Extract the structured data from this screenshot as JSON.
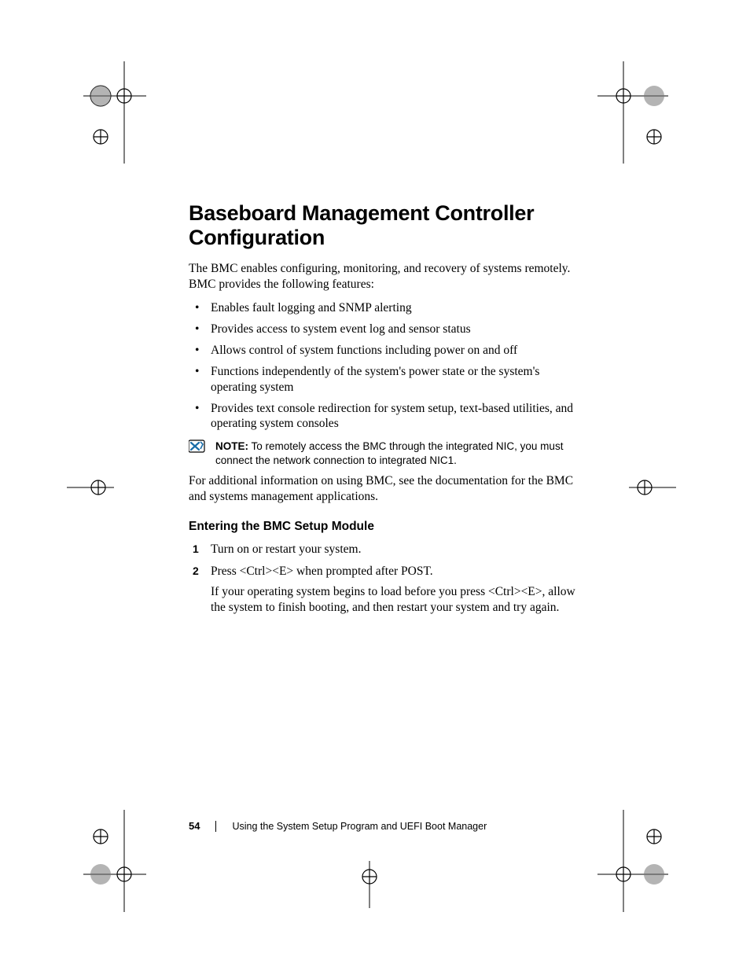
{
  "heading": "Baseboard Management Controller Configuration",
  "intro": "The BMC enables configuring, monitoring, and recovery of systems remotely. BMC provides the following features:",
  "bullets": [
    "Enables fault logging and SNMP alerting",
    "Provides access to system event log and sensor status",
    "Allows control of system functions including power on and off",
    "Functions independently of the system's power state or the system's operating system",
    "Provides text console redirection for system setup, text-based utilities, and operating system consoles"
  ],
  "note_label": "NOTE:",
  "note_text": " To remotely access the BMC through the integrated NIC, you must connect the network connection to integrated NIC1.",
  "after_note": "For additional information on using BMC, see the documentation for the BMC and systems management applications.",
  "subhead": "Entering the BMC Setup Module",
  "steps": [
    {
      "num": "1",
      "text": "Turn on or restart your system."
    },
    {
      "num": "2",
      "text": "Press <Ctrl><E> when prompted after POST.",
      "sub": "If your operating system begins to load before you press <Ctrl><E>, allow the system to finish booting, and then restart your system and try again."
    }
  ],
  "footer": {
    "page": "54",
    "title": "Using the System Setup Program and UEFI Boot Manager"
  }
}
